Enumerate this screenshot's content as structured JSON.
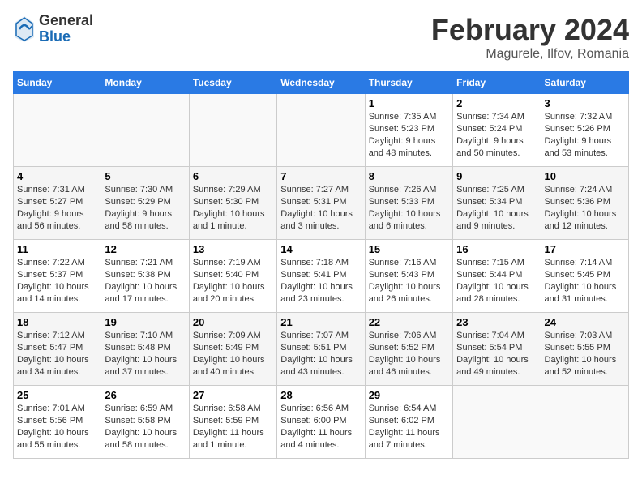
{
  "header": {
    "logo_general": "General",
    "logo_blue": "Blue",
    "month": "February 2024",
    "location": "Magurele, Ilfov, Romania"
  },
  "weekdays": [
    "Sunday",
    "Monday",
    "Tuesday",
    "Wednesday",
    "Thursday",
    "Friday",
    "Saturday"
  ],
  "weeks": [
    [
      {
        "day": "",
        "info": ""
      },
      {
        "day": "",
        "info": ""
      },
      {
        "day": "",
        "info": ""
      },
      {
        "day": "",
        "info": ""
      },
      {
        "day": "1",
        "info": "Sunrise: 7:35 AM\nSunset: 5:23 PM\nDaylight: 9 hours and 48 minutes."
      },
      {
        "day": "2",
        "info": "Sunrise: 7:34 AM\nSunset: 5:24 PM\nDaylight: 9 hours and 50 minutes."
      },
      {
        "day": "3",
        "info": "Sunrise: 7:32 AM\nSunset: 5:26 PM\nDaylight: 9 hours and 53 minutes."
      }
    ],
    [
      {
        "day": "4",
        "info": "Sunrise: 7:31 AM\nSunset: 5:27 PM\nDaylight: 9 hours and 56 minutes."
      },
      {
        "day": "5",
        "info": "Sunrise: 7:30 AM\nSunset: 5:29 PM\nDaylight: 9 hours and 58 minutes."
      },
      {
        "day": "6",
        "info": "Sunrise: 7:29 AM\nSunset: 5:30 PM\nDaylight: 10 hours and 1 minute."
      },
      {
        "day": "7",
        "info": "Sunrise: 7:27 AM\nSunset: 5:31 PM\nDaylight: 10 hours and 3 minutes."
      },
      {
        "day": "8",
        "info": "Sunrise: 7:26 AM\nSunset: 5:33 PM\nDaylight: 10 hours and 6 minutes."
      },
      {
        "day": "9",
        "info": "Sunrise: 7:25 AM\nSunset: 5:34 PM\nDaylight: 10 hours and 9 minutes."
      },
      {
        "day": "10",
        "info": "Sunrise: 7:24 AM\nSunset: 5:36 PM\nDaylight: 10 hours and 12 minutes."
      }
    ],
    [
      {
        "day": "11",
        "info": "Sunrise: 7:22 AM\nSunset: 5:37 PM\nDaylight: 10 hours and 14 minutes."
      },
      {
        "day": "12",
        "info": "Sunrise: 7:21 AM\nSunset: 5:38 PM\nDaylight: 10 hours and 17 minutes."
      },
      {
        "day": "13",
        "info": "Sunrise: 7:19 AM\nSunset: 5:40 PM\nDaylight: 10 hours and 20 minutes."
      },
      {
        "day": "14",
        "info": "Sunrise: 7:18 AM\nSunset: 5:41 PM\nDaylight: 10 hours and 23 minutes."
      },
      {
        "day": "15",
        "info": "Sunrise: 7:16 AM\nSunset: 5:43 PM\nDaylight: 10 hours and 26 minutes."
      },
      {
        "day": "16",
        "info": "Sunrise: 7:15 AM\nSunset: 5:44 PM\nDaylight: 10 hours and 28 minutes."
      },
      {
        "day": "17",
        "info": "Sunrise: 7:14 AM\nSunset: 5:45 PM\nDaylight: 10 hours and 31 minutes."
      }
    ],
    [
      {
        "day": "18",
        "info": "Sunrise: 7:12 AM\nSunset: 5:47 PM\nDaylight: 10 hours and 34 minutes."
      },
      {
        "day": "19",
        "info": "Sunrise: 7:10 AM\nSunset: 5:48 PM\nDaylight: 10 hours and 37 minutes."
      },
      {
        "day": "20",
        "info": "Sunrise: 7:09 AM\nSunset: 5:49 PM\nDaylight: 10 hours and 40 minutes."
      },
      {
        "day": "21",
        "info": "Sunrise: 7:07 AM\nSunset: 5:51 PM\nDaylight: 10 hours and 43 minutes."
      },
      {
        "day": "22",
        "info": "Sunrise: 7:06 AM\nSunset: 5:52 PM\nDaylight: 10 hours and 46 minutes."
      },
      {
        "day": "23",
        "info": "Sunrise: 7:04 AM\nSunset: 5:54 PM\nDaylight: 10 hours and 49 minutes."
      },
      {
        "day": "24",
        "info": "Sunrise: 7:03 AM\nSunset: 5:55 PM\nDaylight: 10 hours and 52 minutes."
      }
    ],
    [
      {
        "day": "25",
        "info": "Sunrise: 7:01 AM\nSunset: 5:56 PM\nDaylight: 10 hours and 55 minutes."
      },
      {
        "day": "26",
        "info": "Sunrise: 6:59 AM\nSunset: 5:58 PM\nDaylight: 10 hours and 58 minutes."
      },
      {
        "day": "27",
        "info": "Sunrise: 6:58 AM\nSunset: 5:59 PM\nDaylight: 11 hours and 1 minute."
      },
      {
        "day": "28",
        "info": "Sunrise: 6:56 AM\nSunset: 6:00 PM\nDaylight: 11 hours and 4 minutes."
      },
      {
        "day": "29",
        "info": "Sunrise: 6:54 AM\nSunset: 6:02 PM\nDaylight: 11 hours and 7 minutes."
      },
      {
        "day": "",
        "info": ""
      },
      {
        "day": "",
        "info": ""
      }
    ]
  ]
}
